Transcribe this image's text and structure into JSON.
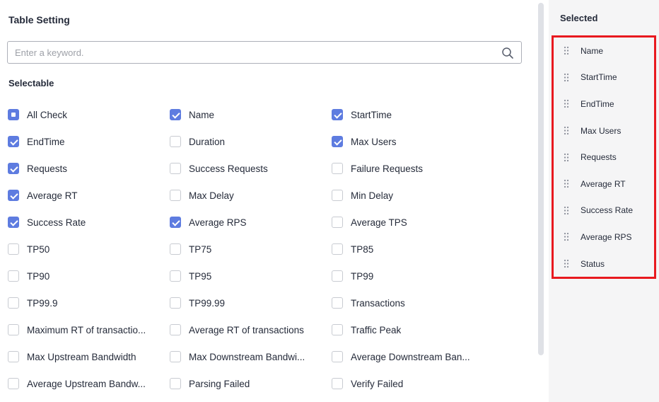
{
  "panel": {
    "title": "Table Setting",
    "search_placeholder": "Enter a keyword.",
    "selectable_label": "Selectable",
    "options": [
      {
        "label": "All Check",
        "state": "partial"
      },
      {
        "label": "Name",
        "state": "checked"
      },
      {
        "label": "StartTime",
        "state": "checked"
      },
      {
        "label": "EndTime",
        "state": "checked"
      },
      {
        "label": "Duration",
        "state": "unchecked"
      },
      {
        "label": "Max Users",
        "state": "checked"
      },
      {
        "label": "Requests",
        "state": "checked"
      },
      {
        "label": "Success Requests",
        "state": "unchecked"
      },
      {
        "label": "Failure Requests",
        "state": "unchecked"
      },
      {
        "label": "Average RT",
        "state": "checked"
      },
      {
        "label": "Max Delay",
        "state": "unchecked"
      },
      {
        "label": "Min Delay",
        "state": "unchecked"
      },
      {
        "label": "Success Rate",
        "state": "checked"
      },
      {
        "label": "Average RPS",
        "state": "checked"
      },
      {
        "label": "Average TPS",
        "state": "unchecked"
      },
      {
        "label": "TP50",
        "state": "unchecked"
      },
      {
        "label": "TP75",
        "state": "unchecked"
      },
      {
        "label": "TP85",
        "state": "unchecked"
      },
      {
        "label": "TP90",
        "state": "unchecked"
      },
      {
        "label": "TP95",
        "state": "unchecked"
      },
      {
        "label": "TP99",
        "state": "unchecked"
      },
      {
        "label": "TP99.9",
        "state": "unchecked"
      },
      {
        "label": "TP99.99",
        "state": "unchecked"
      },
      {
        "label": "Transactions",
        "state": "unchecked"
      },
      {
        "label": "Maximum RT of transactio...",
        "state": "unchecked"
      },
      {
        "label": "Average RT of transactions",
        "state": "unchecked"
      },
      {
        "label": "Traffic Peak",
        "state": "unchecked"
      },
      {
        "label": "Max Upstream Bandwidth",
        "state": "unchecked"
      },
      {
        "label": "Max Downstream Bandwi...",
        "state": "unchecked"
      },
      {
        "label": "Average Downstream Ban...",
        "state": "unchecked"
      },
      {
        "label": "Average Upstream Bandw...",
        "state": "unchecked"
      },
      {
        "label": "Parsing Failed",
        "state": "unchecked"
      },
      {
        "label": "Verify Failed",
        "state": "unchecked"
      }
    ]
  },
  "selected": {
    "title": "Selected",
    "items": [
      "Name",
      "StartTime",
      "EndTime",
      "Max Users",
      "Requests",
      "Average RT",
      "Success Rate",
      "Average RPS",
      "Status"
    ]
  },
  "colors": {
    "accent": "#5e7ce0",
    "highlight_border": "#e8191f",
    "right_panel_bg": "#f5f5f6"
  },
  "icons": {
    "search": "search-icon",
    "drag": "drag-handle-icon"
  }
}
